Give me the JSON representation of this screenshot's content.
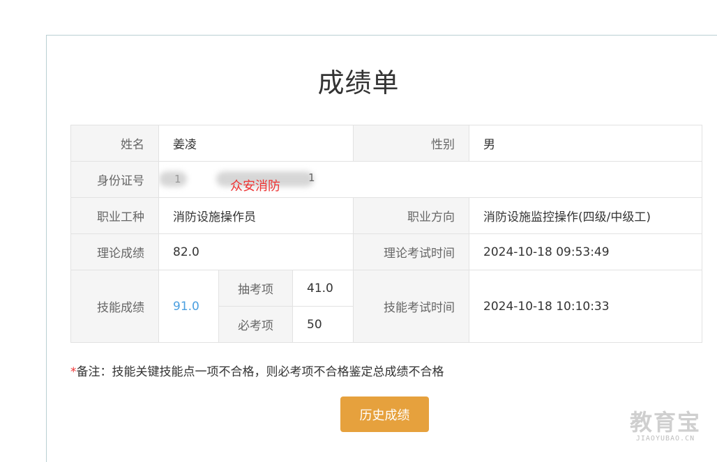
{
  "title": "成绩单",
  "rows": {
    "name": {
      "label": "姓名",
      "value": "姜凌"
    },
    "gender": {
      "label": "性别",
      "value": "男"
    },
    "id_number": {
      "label": "身份证号",
      "visible_fragments": [
        "1",
        "1"
      ],
      "overlay": "众安消防"
    },
    "job_type": {
      "label": "职业工种",
      "value": "消防设施操作员"
    },
    "job_direction": {
      "label": "职业方向",
      "value": "消防设施监控操作(四级/中级工)"
    },
    "theory_score": {
      "label": "理论成绩",
      "value": "82.0"
    },
    "theory_time": {
      "label": "理论考试时间",
      "value": "2024-10-18 09:53:49"
    },
    "skill_score": {
      "label": "技能成绩",
      "value": "91.0"
    },
    "sample_item": {
      "label": "抽考项",
      "value": "41.0"
    },
    "required_item": {
      "label": "必考项",
      "value": "50"
    },
    "skill_time": {
      "label": "技能考试时间",
      "value": "2024-10-18 10:10:33"
    }
  },
  "note": {
    "star": "*",
    "text": "备注：技能关键技能点一项不合格，则必考项不合格鉴定总成绩不合格"
  },
  "history_button": "历史成绩",
  "logo": {
    "main": "教育宝",
    "sub": "JIAOYUBAO.CN"
  },
  "colors": {
    "accent_button": "#e6a13d",
    "skill_score": "#4a9fe0",
    "required_star": "#e33333",
    "label_bg": "#f5f5f5"
  }
}
